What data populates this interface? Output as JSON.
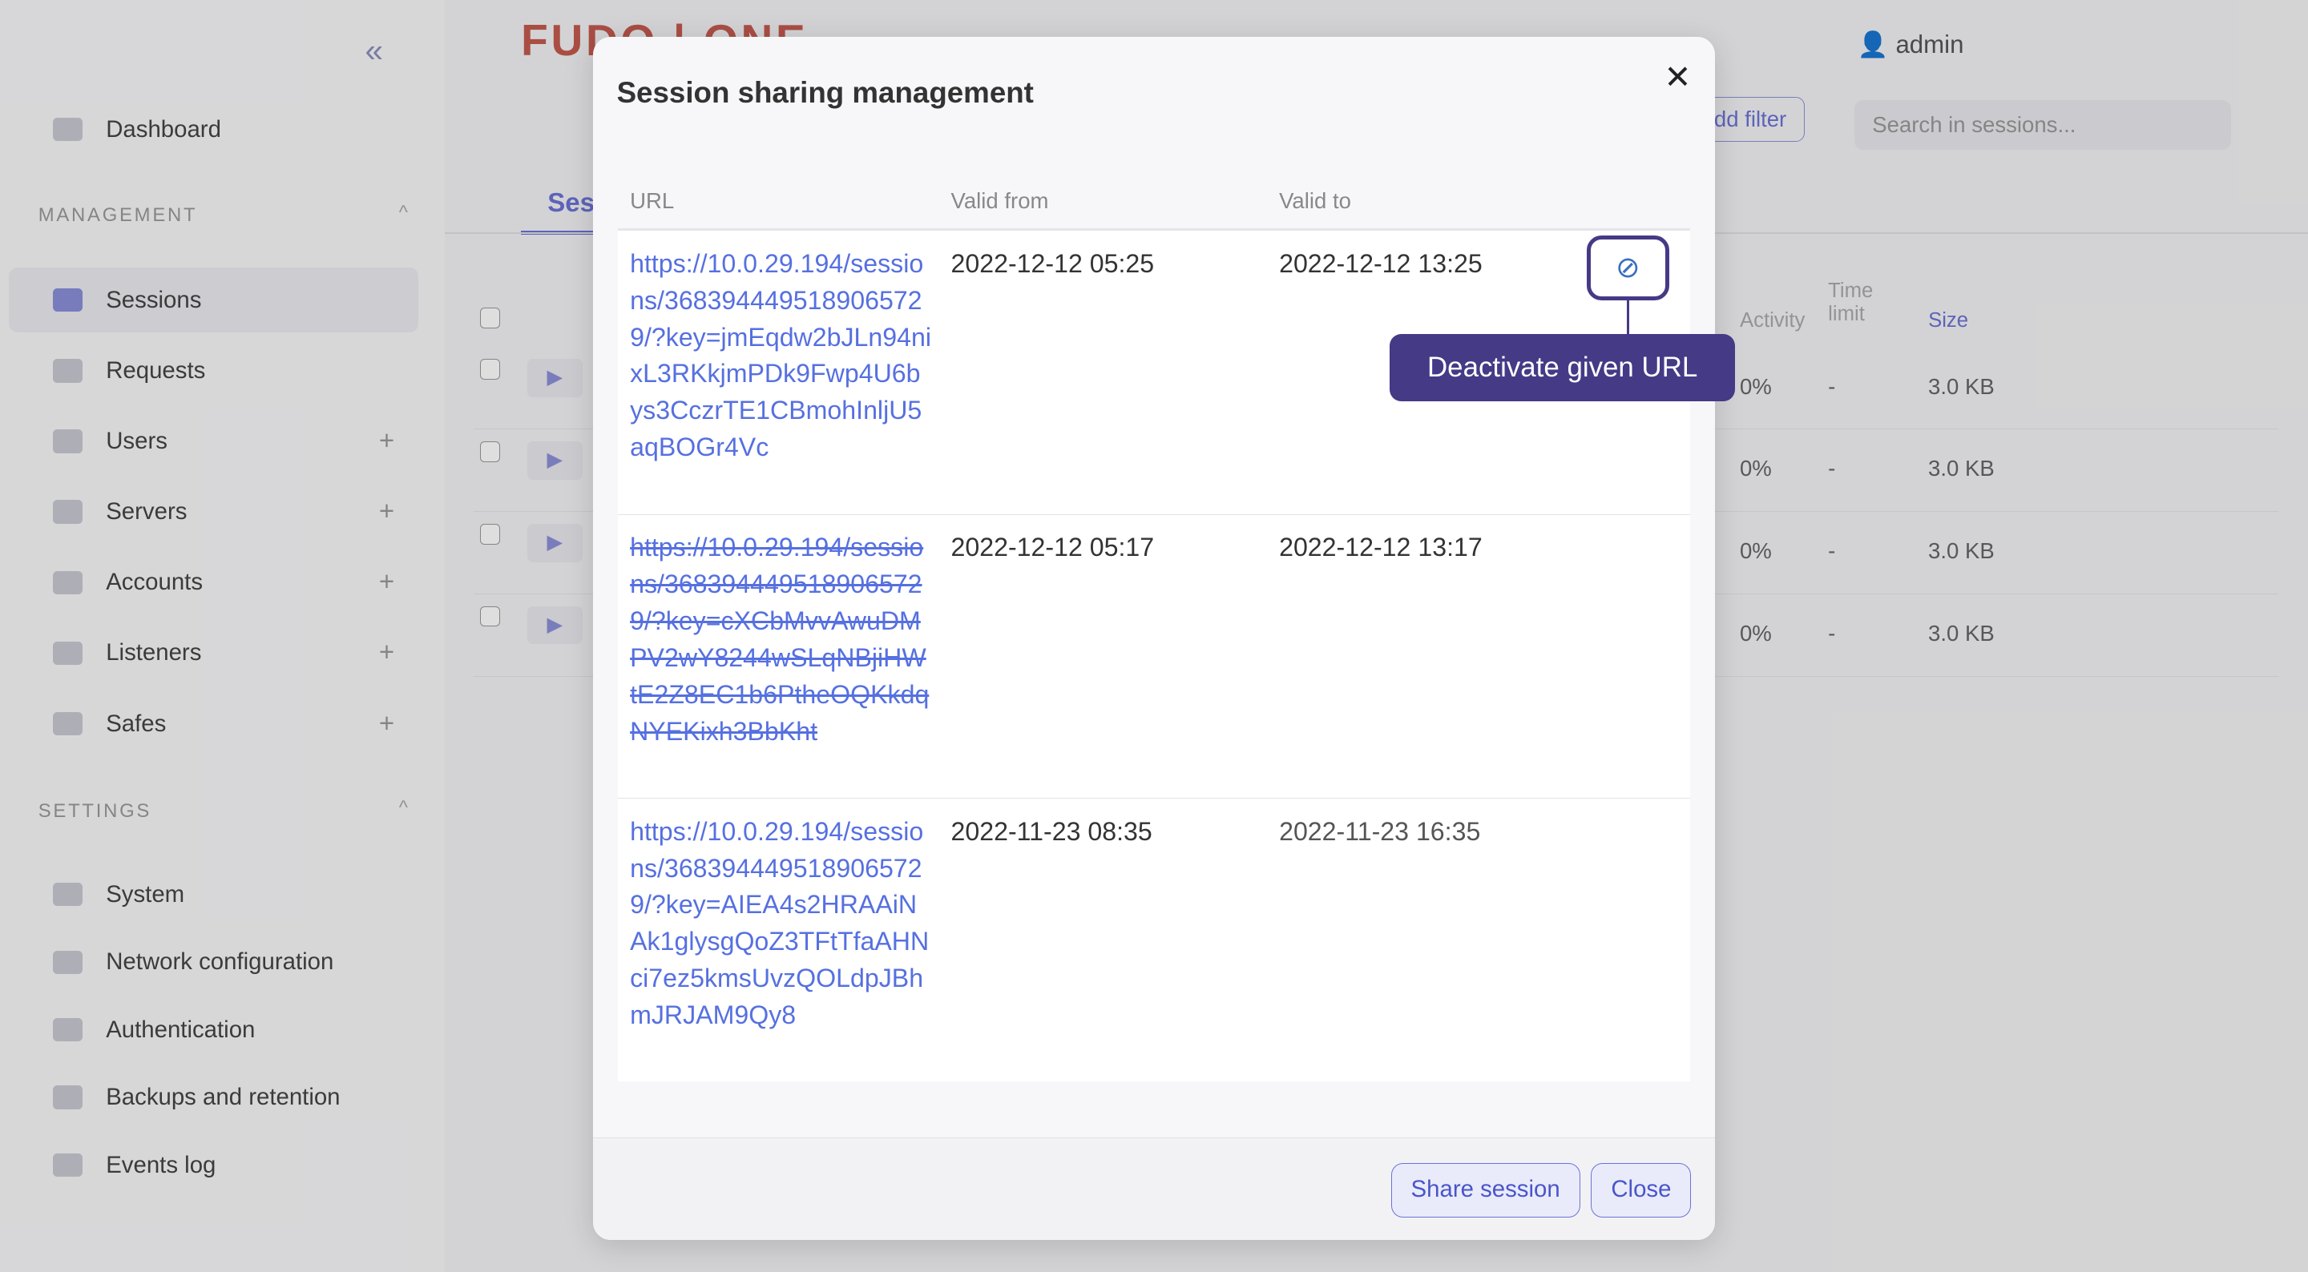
{
  "sidebar": {
    "items_top": [
      {
        "label": "Dashboard",
        "icon": "dashboard-icon"
      }
    ],
    "management_label": "MANAGEMENT",
    "management": [
      {
        "label": "Sessions",
        "icon": "sessions-icon",
        "active": true
      },
      {
        "label": "Requests",
        "icon": "requests-icon"
      },
      {
        "label": "Users",
        "icon": "users-icon",
        "plus": "+"
      },
      {
        "label": "Servers",
        "icon": "servers-icon",
        "plus": "+"
      },
      {
        "label": "Accounts",
        "icon": "accounts-icon",
        "plus": "+"
      },
      {
        "label": "Listeners",
        "icon": "listeners-icon",
        "plus": "+"
      },
      {
        "label": "Safes",
        "icon": "safes-icon",
        "plus": "+"
      }
    ],
    "settings_label": "SETTINGS",
    "settings": [
      {
        "label": "System"
      },
      {
        "label": "Network configuration"
      },
      {
        "label": "Authentication"
      },
      {
        "label": "Backups and retention"
      },
      {
        "label": "Events log"
      }
    ]
  },
  "header": {
    "logo": "FUDO | ONE",
    "user": "admin",
    "add_filter": "dd filter",
    "search_placeholder": "Search in sessions...",
    "tab": "Ses"
  },
  "bg_table": {
    "headers": {
      "activity": "Activity",
      "time_limit": "Time limit",
      "size": "Size"
    },
    "rows": [
      {
        "activity": "0%",
        "time_limit": "-",
        "size": "3.0 KB"
      },
      {
        "activity": "0%",
        "time_limit": "-",
        "size": "3.0 KB"
      },
      {
        "activity": "0%",
        "time_limit": "-",
        "size": "3.0 KB"
      },
      {
        "activity": "0%",
        "time_limit": "-",
        "size": "3.0 KB"
      }
    ]
  },
  "modal": {
    "title": "Session sharing management",
    "columns": {
      "url": "URL",
      "valid_from": "Valid from",
      "valid_to": "Valid to"
    },
    "rows": [
      {
        "url": "https://10.0.29.194/sessions/3683944495189065729/?key=jmEqdw2bJLn94nixL3RKkjmPDk9Fwp4U6bys3CczrTE1CBmohInljU5aqBOGr4Vc",
        "valid_from": "2022-12-12 05:25",
        "valid_to": "2022-12-12 13:25",
        "deactivated": false
      },
      {
        "url": "https://10.0.29.194/sessions/3683944495189065729/?key=cXCbMvvAwuDMPV2wY8244wSLqNBjiHWtE2Z8EC1b6PtheOQKkdqNYEKixh3BbKht",
        "valid_from": "2022-12-12 05:17",
        "valid_to": "2022-12-12 13:17",
        "deactivated": true
      },
      {
        "url": "https://10.0.29.194/sessions/3683944495189065729/?key=AIEA4s2HRAAiNAk1glysgQoZ3TFtTfaAHNci7ez5kmsUvzQOLdpJBhmJRJAM9Qy8",
        "valid_from": "2022-11-23 08:35",
        "valid_to": "2022-11-23 16:35",
        "deactivated": false
      }
    ],
    "tooltip": "Deactivate given URL",
    "share_button": "Share session",
    "close_button": "Close",
    "colors": {
      "link": "#5670e0",
      "tooltip": "#453a86"
    }
  }
}
